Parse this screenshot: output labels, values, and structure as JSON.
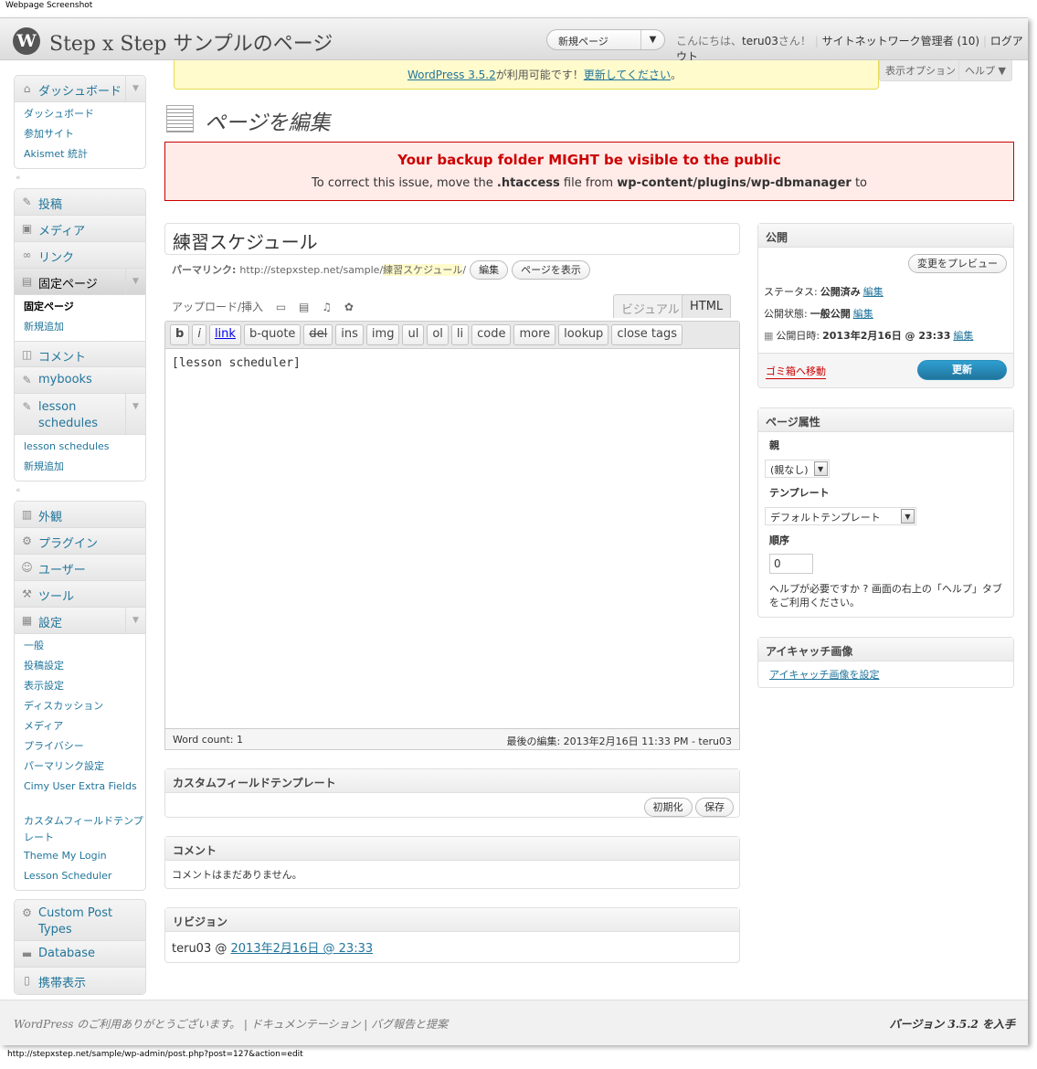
{
  "frame": {
    "caption": "Webpage Screenshot",
    "status_url": "http://stepxstep.net/sample/wp-admin/post.php?post=127&action=edit"
  },
  "header": {
    "logo": "W",
    "site_title": "Step x Step サンプルのページ",
    "new_page_dropdown": "新規ページ",
    "greeting_prefix": "こんにちは、",
    "user": "teru03",
    "greeting_suffix": "さん！",
    "network_admin": "サイトネットワーク管理者 (10)",
    "logout": "ログアウト"
  },
  "update_nag": {
    "link1": "WordPress 3.5.2",
    "mid": "が利用可能です！",
    "link2": "更新してください",
    "end": "。"
  },
  "screen_options": "表示オプション ▼",
  "help": "ヘルプ ▼",
  "menu": {
    "dashboard": "ダッシュボード",
    "dashboard_sub": [
      "ダッシュボード",
      "参加サイト",
      "Akismet 統計"
    ],
    "posts": "投稿",
    "media": "メディア",
    "links": "リンク",
    "pages": "固定ページ",
    "pages_sub": [
      "固定ページ",
      "新規追加"
    ],
    "comments": "コメント",
    "mybooks": "mybooks",
    "lesson": "lesson schedules",
    "lesson_sub": [
      "lesson schedules",
      "新規追加"
    ],
    "appearance": "外観",
    "plugins": "プラグイン",
    "users": "ユーザー",
    "tools": "ツール",
    "settings": "設定",
    "settings_sub": [
      "一般",
      "投稿設定",
      "表示設定",
      "ディスカッション",
      "メディア",
      "プライバシー",
      "パーマリンク設定",
      "Cimy User Extra Fields",
      "カスタムフィールドテンプレート",
      "Theme My Login",
      "Lesson Scheduler"
    ],
    "cpt": "Custom Post Types",
    "database": "Database",
    "mobile": "携帯表示"
  },
  "page_title": "ページを編集",
  "error": {
    "title": "Your backup folder MIGHT be visible to the public",
    "msg_a": "To correct this issue, move the ",
    "msg_b": ".htaccess",
    "msg_c": " file from ",
    "msg_d": "wp-content/plugins/wp-dbmanager",
    "msg_e": " to"
  },
  "post": {
    "title": "練習スケジュール",
    "permalink_label": "パーマリンク:",
    "permalink_base": "http://stepxstep.net/sample/",
    "permalink_slug": "練習スケジュール",
    "permalink_end": "/",
    "edit_btn": "編集",
    "view_btn": "ページを表示",
    "upload_label": "アップロード/挿入",
    "tab_visual": "ビジュアル",
    "tab_html": "HTML",
    "quicktags": [
      "b",
      "i",
      "link",
      "b-quote",
      "del",
      "ins",
      "img",
      "ul",
      "ol",
      "li",
      "code",
      "more",
      "lookup",
      "close tags"
    ],
    "content": "[lesson scheduler]",
    "word_count": "Word count: 1",
    "last_edit": "最後の編集: 2013年2月16日 11:33 PM - teru03"
  },
  "cft": {
    "title": "カスタムフィールドテンプレート",
    "init": "初期化",
    "save": "保存"
  },
  "comments": {
    "title": "コメント",
    "text": "コメントはまだありません。"
  },
  "revisions": {
    "title": "リビジョン",
    "prefix": "teru03 @ ",
    "link": "2013年2月16日 @ 23:33"
  },
  "publish": {
    "title": "公開",
    "preview": "変更をプレビュー",
    "status_label": "ステータス:",
    "status_val": "公開済み",
    "status_edit": "編集",
    "vis_label": "公開状態:",
    "vis_val": "一般公開",
    "vis_edit": "編集",
    "date_label": "公開日時:",
    "date_val": "2013年2月16日 @ 23:33",
    "date_edit": "編集",
    "trash": "ゴミ箱へ移動",
    "update": "更新"
  },
  "attributes": {
    "title": "ページ属性",
    "parent_label": "親",
    "parent_val": "(親なし)",
    "template_label": "テンプレート",
    "template_val": "デフォルトテンプレート",
    "order_label": "順序",
    "order_val": "0",
    "help": "ヘルプが必要ですか ? 画面の右上の「ヘルプ」タブをご利用ください。"
  },
  "thumbnail": {
    "title": "アイキャッチ画像",
    "link": "アイキャッチ画像を設定"
  },
  "footer": {
    "thanks": "WordPress のご利用ありがとうございます。",
    "docs": "ドキュメンテーション",
    "bugs": "バグ報告と提案",
    "version": "バージョン 3.5.2 を入手"
  }
}
